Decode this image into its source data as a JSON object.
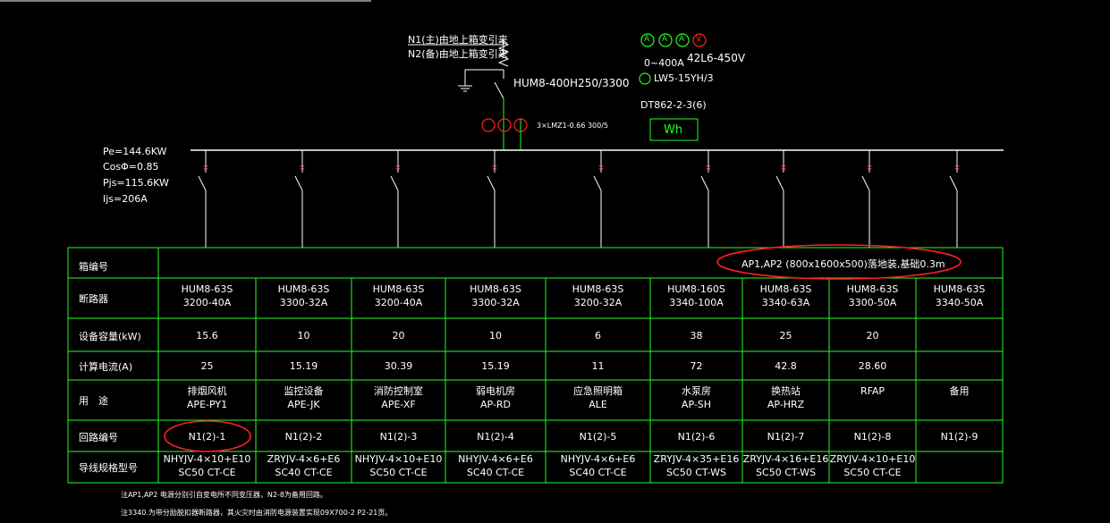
{
  "supply": {
    "source_main": "N1(主)由地上箱变引来",
    "source_backup": "N2(备)由地上箱变引来",
    "main_breaker": "HUM8-400H250/3300",
    "ct": "3×LMZ1-0.66 300/5",
    "meters": [
      "A",
      "A",
      "A",
      "V"
    ],
    "meter_range": "0~400A",
    "meter_type": "42L6-450V",
    "switch_label": "LW5-15YH/3",
    "energy_meter_model": "DT862-2-3(6)",
    "energy_meter_symbol": "Wh"
  },
  "load_calc": {
    "pe": "Pe=144.6KW",
    "cos": "CosΦ=0.85",
    "pjs": "Pjs=115.6KW",
    "ijs": "Ijs=206A"
  },
  "table": {
    "row_labels": [
      "箱编号",
      "断路器",
      "设备容量(kW)",
      "计算电流(A)",
      "用　途",
      "回路编号",
      "导线规格型号"
    ],
    "box_id": "AP1,AP2 (800x1600x500)落地装,基础0.3m",
    "circuits": [
      {
        "breaker1": "HUM8-63S",
        "breaker2": "3200-40A",
        "kw": "15.6",
        "current": "25",
        "use1": "排烟风机",
        "use2": "APE-PY1",
        "circuit": "N1(2)-1",
        "cable1": "NHYJV-4×10+E10",
        "cable2": "SC50 CT-CE"
      },
      {
        "breaker1": "HUM8-63S",
        "breaker2": "3300-32A",
        "kw": "10",
        "current": "15.19",
        "use1": "监控设备",
        "use2": "APE-JK",
        "circuit": "N1(2)-2",
        "cable1": "ZRYJV-4×6+E6",
        "cable2": "SC40 CT-CE"
      },
      {
        "breaker1": "HUM8-63S",
        "breaker2": "3200-40A",
        "kw": "20",
        "current": "30.39",
        "use1": "消防控制室",
        "use2": "APE-XF",
        "circuit": "N1(2)-3",
        "cable1": "NHYJV-4×10+E10",
        "cable2": "SC50 CT-CE"
      },
      {
        "breaker1": "HUM8-63S",
        "breaker2": "3300-32A",
        "kw": "10",
        "current": "15.19",
        "use1": "弱电机房",
        "use2": "AP-RD",
        "circuit": "N1(2)-4",
        "cable1": "NHYJV-4×6+E6",
        "cable2": "SC40 CT-CE"
      },
      {
        "breaker1": "HUM8-63S",
        "breaker2": "3200-32A",
        "kw": "6",
        "current": "11",
        "use1": "应急照明箱",
        "use2": "ALE",
        "circuit": "N1(2)-5",
        "cable1": "NHYJV-4×6+E6",
        "cable2": "SC40 CT-CE"
      },
      {
        "breaker1": "HUM8-160S",
        "breaker2": "3340-100A",
        "kw": "38",
        "current": "72",
        "use1": "水泵房",
        "use2": "AP-SH",
        "circuit": "N1(2)-6",
        "cable1": "ZRYJV-4×35+E16",
        "cable2": "SC50 CT-WS"
      },
      {
        "breaker1": "HUM8-63S",
        "breaker2": "3340-63A",
        "kw": "25",
        "current": "42.8",
        "use1": "换热站",
        "use2": "AP-HRZ",
        "circuit": "N1(2)-7",
        "cable1": "ZRYJV-4×16+E16",
        "cable2": "SC50 CT-WS"
      },
      {
        "breaker1": "HUM8-63S",
        "breaker2": "3300-50A",
        "kw": "20",
        "current": "28.60",
        "use1": "RFAP",
        "use2": "",
        "circuit": "N1(2)-8",
        "cable1": "ZRYJV-4×10+E10",
        "cable2": "SC50 CT-CE"
      },
      {
        "breaker1": "HUM8-63S",
        "breaker2": "3340-50A",
        "kw": "",
        "current": "",
        "use1": "备用",
        "use2": "",
        "circuit": "N1(2)-9",
        "cable1": "",
        "cable2": ""
      }
    ]
  },
  "notes": [
    "注AP1,AP2 电源分别引自变电所不同变压器，N2-8为备用回路。",
    "注3340.为带分励脱扣器断路器，其火灾时由消防电源装置实现09X700-2 P2-21页。"
  ],
  "colors": {
    "background": "#000000",
    "line": "#22ff22",
    "text": "#ffffff",
    "highlight": "#ff2020",
    "breaker_mark": "#ff4040"
  }
}
